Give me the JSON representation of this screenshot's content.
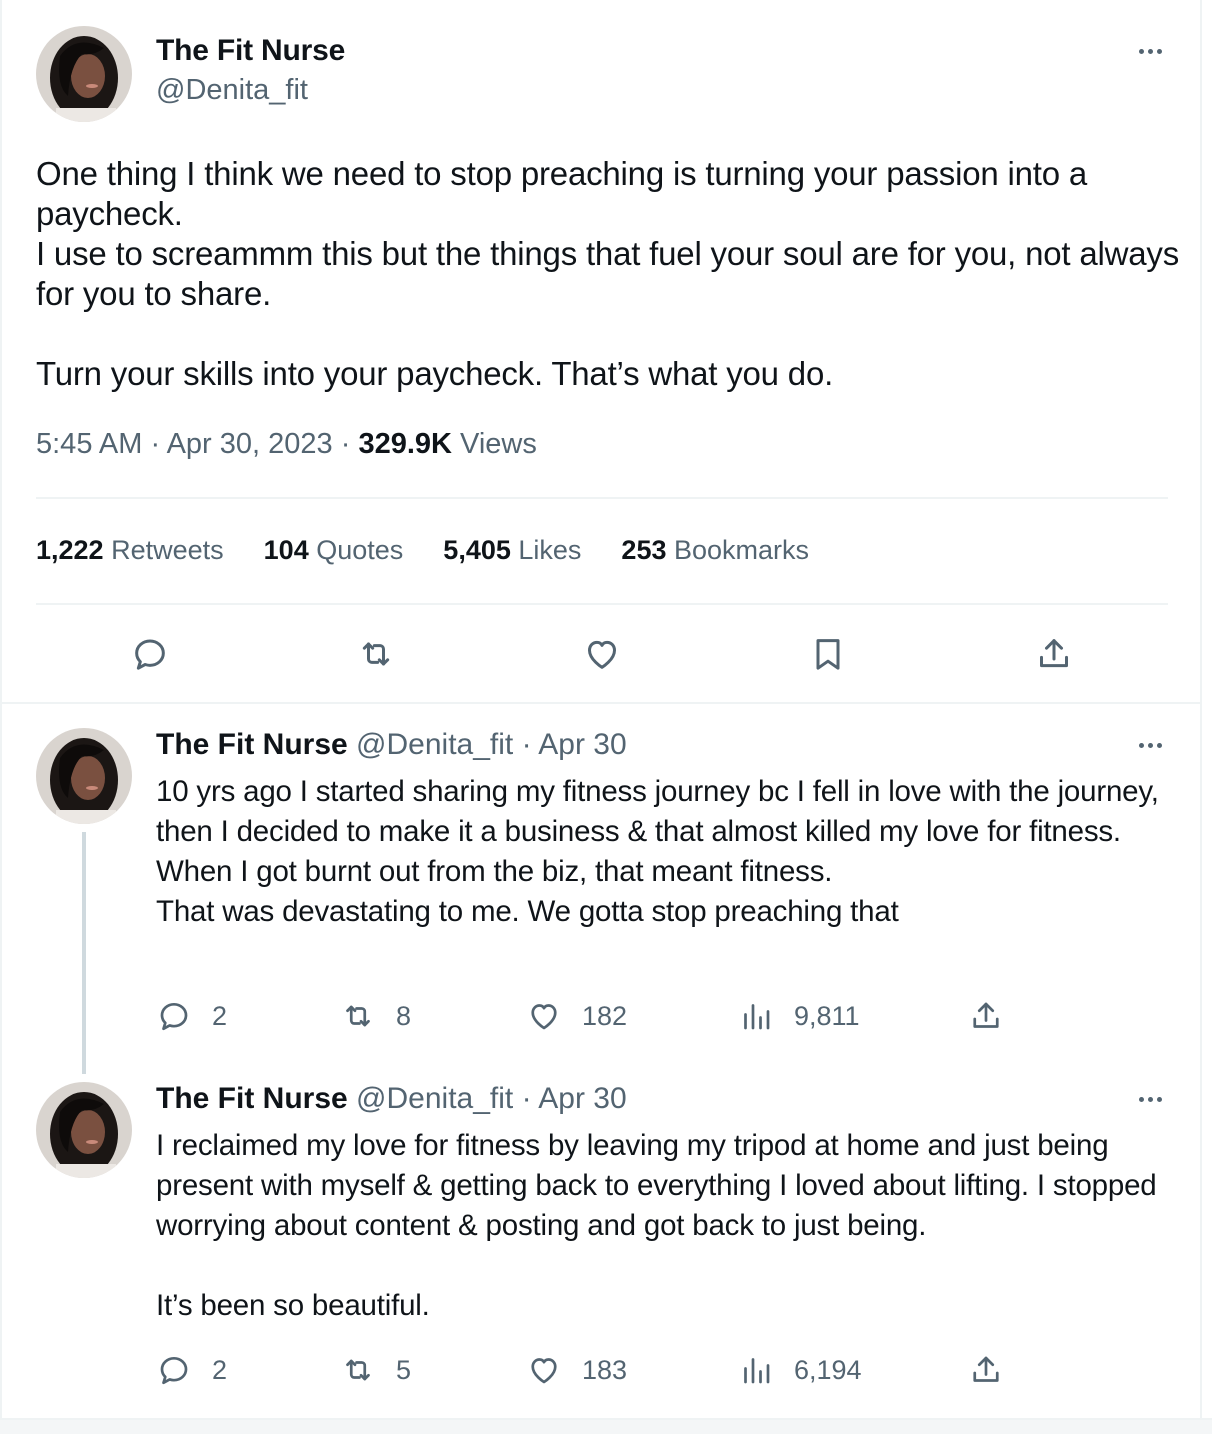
{
  "main_tweet": {
    "author_name": "The Fit Nurse",
    "author_handle": "@Denita_fit",
    "text": "One thing I think we need to stop preaching is turning your passion into a paycheck.\nI use to screammm this but the things that fuel your soul are for you, not always for you to share.\n\nTurn your skills into your paycheck. That’s what you do.",
    "time": "5:45 AM",
    "date": "Apr 30, 2023",
    "views_count": "329.9K",
    "views_label": "Views",
    "stats": [
      {
        "count": "1,222",
        "label": "Retweets"
      },
      {
        "count": "104",
        "label": "Quotes"
      },
      {
        "count": "5,405",
        "label": "Likes"
      },
      {
        "count": "253",
        "label": "Bookmarks"
      }
    ],
    "actions": [
      "reply-icon",
      "retweet-icon",
      "like-icon",
      "bookmark-icon",
      "share-icon"
    ]
  },
  "replies": [
    {
      "author_name": "The Fit Nurse",
      "author_handle": "@Denita_fit",
      "date": "Apr 30",
      "text": "10 yrs ago I started sharing my fitness journey bc I fell in love with the journey, then I decided to make it a business & that almost killed my love for fitness.\nWhen I got burnt out from the biz, that meant fitness.\nThat was devastating to me. We gotta stop preaching that",
      "replies": "2",
      "retweets": "8",
      "likes": "182",
      "views": "9,811"
    },
    {
      "author_name": "The Fit Nurse",
      "author_handle": "@Denita_fit",
      "date": "Apr 30",
      "text": "I reclaimed my love for fitness by leaving my tripod at home and just being present with myself & getting back to everything I loved about lifting. I stopped worrying about content & posting and got back to just being.\n\nIt’s been so beautiful.",
      "replies": "2",
      "retweets": "5",
      "likes": "183",
      "views": "6,194"
    }
  ],
  "colors": {
    "text_primary": "#0f1419",
    "text_secondary": "#536471",
    "divider": "#eff3f4",
    "thread_line": "#cfd9de"
  }
}
